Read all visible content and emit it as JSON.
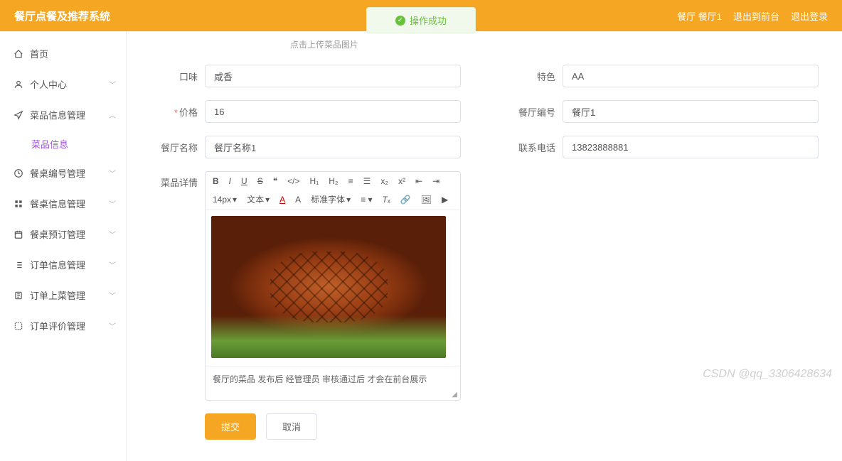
{
  "header": {
    "title": "餐厅点餐及推荐系统",
    "user_label": "餐厅 餐厅1",
    "exit_front": "退出到前台",
    "logout": "退出登录"
  },
  "alert": {
    "text": "操作成功"
  },
  "sidebar": {
    "home": "首页",
    "personal": "个人中心",
    "dish_mgmt": "菜品信息管理",
    "dish_info": "菜品信息",
    "table_num_mgmt": "餐桌编号管理",
    "table_info_mgmt": "餐桌信息管理",
    "table_reserve_mgmt": "餐桌预订管理",
    "order_info_mgmt": "订单信息管理",
    "order_serve_mgmt": "订单上菜管理",
    "order_review_mgmt": "订单评价管理"
  },
  "form": {
    "upload_hint": "点击上传菜品图片",
    "taste_label": "口味",
    "taste_value": "咸香",
    "feature_label": "特色",
    "feature_value": "AA",
    "price_label": "价格",
    "price_value": "16",
    "rest_id_label": "餐厅编号",
    "rest_id_value": "餐厅1",
    "rest_name_label": "餐厅名称",
    "rest_name_value": "餐厅名称1",
    "phone_label": "联系电话",
    "phone_value": "13823888881",
    "detail_label": "菜品详情",
    "detail_text": "餐厅的菜品 发布后  经管理员 审核通过后 才会在前台展示",
    "submit": "提交",
    "cancel": "取消"
  },
  "editor": {
    "font_size": "14px",
    "text_type": "文本",
    "font_family": "标准字体"
  },
  "watermark": "CSDN @qq_3306428634"
}
